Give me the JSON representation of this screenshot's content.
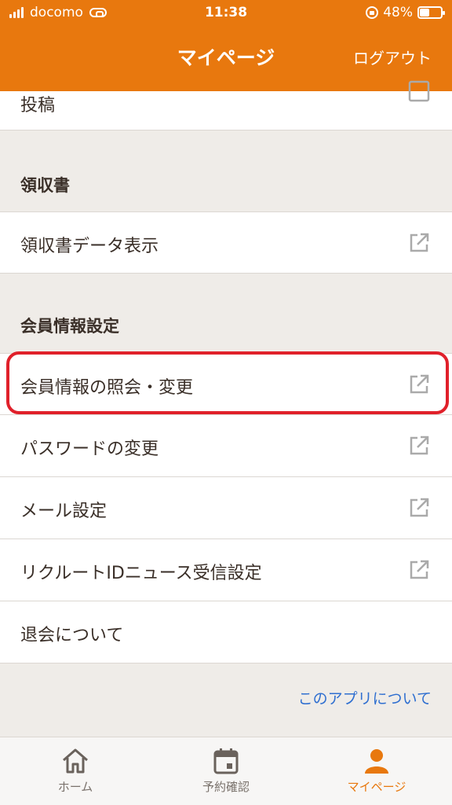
{
  "status_bar": {
    "carrier": "docomo",
    "time": "11:38",
    "battery": "48%",
    "battery_level": 0.48
  },
  "header": {
    "title": "マイページ",
    "logout_label": "ログアウト"
  },
  "sections": {
    "top_item": "投稿",
    "receipt": {
      "title": "領収書",
      "items": [
        "領収書データ表示"
      ]
    },
    "member": {
      "title": "会員情報設定",
      "items": [
        "会員情報の照会・変更",
        "パスワードの変更",
        "メール設定",
        "リクルートIDニュース受信設定",
        "退会について"
      ]
    }
  },
  "about_link": "このアプリについて",
  "tabbar": {
    "tabs": [
      {
        "label": "ホーム",
        "icon": "home-icon"
      },
      {
        "label": "予約確認",
        "icon": "calendar-icon"
      },
      {
        "label": "マイページ",
        "icon": "person-icon"
      }
    ],
    "active_index": 2
  },
  "colors": {
    "accent": "#e8780e",
    "highlight": "#e0202a",
    "link": "#2f6fd0"
  }
}
